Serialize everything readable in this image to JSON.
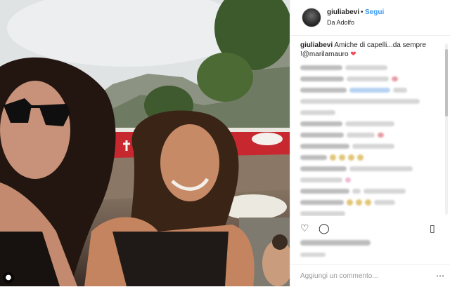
{
  "post": {
    "photo_name": "beach selfie",
    "user_badge_icon": "user-icon"
  },
  "header": {
    "username": "giuliabevi",
    "separator": "•",
    "follow_label": "Segui",
    "location": "Da Adolfo"
  },
  "caption": {
    "username": "giuliabevi",
    "text": "Amiche di capelli...da sempre !@marilamauro",
    "heart": "❤"
  },
  "colors": {
    "accent": "#3897f0",
    "heart": "#ed4956"
  },
  "comment_input": {
    "placeholder": "Aggiungi un commento..."
  }
}
